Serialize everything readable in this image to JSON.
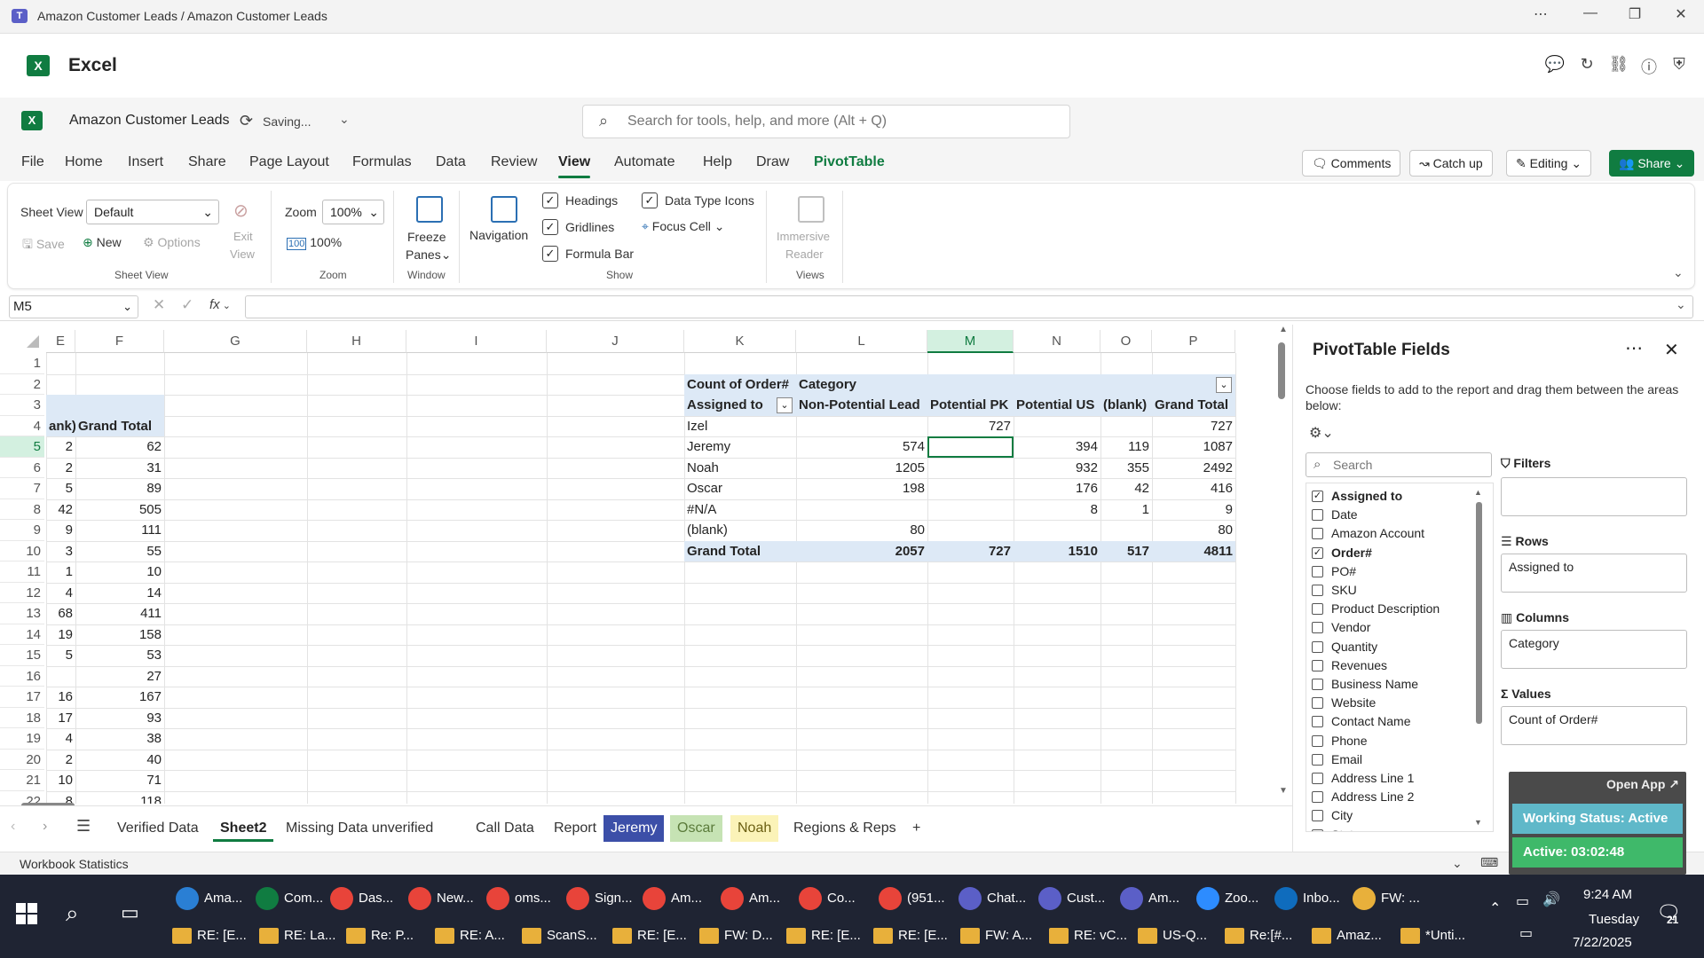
{
  "window": {
    "title": "Amazon Customer Leads / Amazon Customer Leads"
  },
  "app": {
    "name": "Excel"
  },
  "doc": {
    "name": "Amazon Customer Leads",
    "status": "Saving...",
    "search_placeholder": "Search for tools, help, and more (Alt + Q)"
  },
  "menu": {
    "file": "File",
    "home": "Home",
    "insert": "Insert",
    "share": "Share",
    "page_layout": "Page Layout",
    "formulas": "Formulas",
    "data": "Data",
    "review": "Review",
    "view": "View",
    "automate": "Automate",
    "help": "Help",
    "draw": "Draw",
    "pivottable": "PivotTable"
  },
  "topbuttons": {
    "comments": "Comments",
    "catchup": "Catch up",
    "editing": "Editing",
    "share": "Share"
  },
  "ribbon": {
    "sheet_view_label": "Sheet View",
    "sheet_view_value": "Default",
    "save": "Save",
    "new": "New",
    "options": "Options",
    "exit": "Exit",
    "view_word": "View",
    "group_sheet_view": "Sheet View",
    "zoom_label": "Zoom",
    "zoom_value": "100%",
    "zoom_100": "100%",
    "group_zoom": "Zoom",
    "freeze": "Freeze",
    "panes": "Panes",
    "group_window": "Window",
    "navigation": "Navigation",
    "headings": "Headings",
    "gridlines": "Gridlines",
    "formula_bar": "Formula Bar",
    "data_type_icons": "Data Type Icons",
    "focus_cell": "Focus Cell",
    "group_show": "Show",
    "immersive": "Immersive",
    "reader": "Reader",
    "group_views": "Views"
  },
  "formula": {
    "namebox": "M5",
    "fx": "fx",
    "value": ""
  },
  "grid": {
    "columns": [
      {
        "name": "E",
        "sel": false
      },
      {
        "name": "F",
        "sel": false
      },
      {
        "name": "G",
        "sel": false
      },
      {
        "name": "H",
        "sel": false
      },
      {
        "name": "I",
        "sel": false
      },
      {
        "name": "J",
        "sel": false
      },
      {
        "name": "K",
        "sel": false
      },
      {
        "name": "L",
        "sel": false
      },
      {
        "name": "M",
        "sel": true
      },
      {
        "name": "N",
        "sel": false
      },
      {
        "name": "O",
        "sel": false
      },
      {
        "name": "P",
        "sel": false
      }
    ],
    "rows": [
      "1",
      "2",
      "3",
      "4",
      "5",
      "6",
      "7",
      "8",
      "9",
      "10",
      "11",
      "12",
      "13",
      "14",
      "15",
      "16",
      "17",
      "18",
      "19",
      "20",
      "21",
      "22"
    ],
    "selected_row": "5",
    "left_table": {
      "header": [
        "ank)",
        "Grand Total"
      ],
      "rows": [
        [
          "2",
          "62"
        ],
        [
          "2",
          "31"
        ],
        [
          "5",
          "89"
        ],
        [
          "42",
          "505"
        ],
        [
          "9",
          "111"
        ],
        [
          "3",
          "55"
        ],
        [
          "1",
          "10"
        ],
        [
          "4",
          "14"
        ],
        [
          "68",
          "411"
        ],
        [
          "19",
          "158"
        ],
        [
          "5",
          "53"
        ],
        [
          "",
          "27"
        ],
        [
          "16",
          "167"
        ],
        [
          "17",
          "93"
        ],
        [
          "4",
          "38"
        ],
        [
          "2",
          "40"
        ],
        [
          "10",
          "71"
        ],
        [
          "8",
          "118"
        ]
      ]
    },
    "pivot": {
      "value_field": "Count of Order#",
      "column_field": "Category",
      "row_field": "Assigned to",
      "columns": [
        "Non-Potential Lead",
        "Potential PK",
        "Potential US",
        "(blank)",
        "Grand Total"
      ],
      "rows": [
        {
          "label": "Izel",
          "values": [
            "",
            "727",
            "",
            "",
            "727"
          ]
        },
        {
          "label": "Jeremy",
          "values": [
            "574",
            "",
            "394",
            "119",
            "1087"
          ]
        },
        {
          "label": "Noah",
          "values": [
            "1205",
            "",
            "932",
            "355",
            "2492"
          ]
        },
        {
          "label": "Oscar",
          "values": [
            "198",
            "",
            "176",
            "42",
            "416"
          ]
        },
        {
          "label": "#N/A",
          "values": [
            "",
            "",
            "8",
            "1",
            "9"
          ]
        },
        {
          "label": "(blank)",
          "values": [
            "80",
            "",
            "",
            "",
            "80"
          ]
        }
      ],
      "total": {
        "label": "Grand Total",
        "values": [
          "2057",
          "727",
          "1510",
          "517",
          "4811"
        ]
      }
    }
  },
  "sheets": [
    {
      "name": "Verified Data",
      "style": "normal"
    },
    {
      "name": "Sheet2",
      "style": "active"
    },
    {
      "name": "Missing Data unverified",
      "style": "normal"
    },
    {
      "name": "Call Data",
      "style": "normal"
    },
    {
      "name": "Report",
      "style": "normal"
    },
    {
      "name": "Jeremy",
      "style": "blue"
    },
    {
      "name": "Oscar",
      "style": "green"
    },
    {
      "name": "Noah",
      "style": "yellow"
    },
    {
      "name": "Regions & Reps",
      "style": "normal"
    }
  ],
  "status": {
    "left": "Workbook Statistics"
  },
  "pivotpane": {
    "title": "PivotTable Fields",
    "description": "Choose fields to add to the report and drag them between the areas below:",
    "search_placeholder": "Search",
    "fields": [
      {
        "name": "Assigned to",
        "checked": true
      },
      {
        "name": "Date",
        "checked": false
      },
      {
        "name": "Amazon Account",
        "checked": false
      },
      {
        "name": "Order#",
        "checked": true
      },
      {
        "name": "PO#",
        "checked": false
      },
      {
        "name": "SKU",
        "checked": false
      },
      {
        "name": "Product Description",
        "checked": false
      },
      {
        "name": "Vendor",
        "checked": false
      },
      {
        "name": "Quantity",
        "checked": false
      },
      {
        "name": "Revenues",
        "checked": false
      },
      {
        "name": "Business Name",
        "checked": false
      },
      {
        "name": "Website",
        "checked": false
      },
      {
        "name": "Contact Name",
        "checked": false
      },
      {
        "name": "Phone",
        "checked": false
      },
      {
        "name": "Email",
        "checked": false
      },
      {
        "name": "Address Line 1",
        "checked": false
      },
      {
        "name": "Address Line 2",
        "checked": false
      },
      {
        "name": "City",
        "checked": false
      },
      {
        "name": "State",
        "checked": false
      }
    ],
    "filters_label": "Filters",
    "filters_value": "",
    "rows_label": "Rows",
    "rows_value": "Assigned to",
    "columns_label": "Columns",
    "columns_value": "Category",
    "values_label": "Values",
    "values_value": "Count of Order#"
  },
  "widget": {
    "open_app": "Open App ↗",
    "status": "Working Status: Active",
    "active": "Active: 03:02:48",
    "zoom": "100%"
  },
  "taskbar": {
    "row1": [
      "Ama...",
      "Com...",
      "Das...",
      "New...",
      "oms...",
      "Sign...",
      "Am...",
      "Am...",
      "Co...",
      "(951...",
      "Chat...",
      "Cust...",
      "Am...",
      "Zoo...",
      "Inbo...",
      "FW: ..."
    ],
    "row2": [
      "RE: [E...",
      "RE: La...",
      "Re: P...",
      "RE: A...",
      "ScanS...",
      "RE: [E...",
      "FW: D...",
      "RE: [E...",
      "RE: [E...",
      "FW: A...",
      "RE: vC...",
      "US-Q...",
      "Re:[#...",
      "Amaz...",
      "*Unti..."
    ],
    "time": "9:24 AM",
    "day": "Tuesday",
    "date": "7/22/2025",
    "notif": "21"
  }
}
